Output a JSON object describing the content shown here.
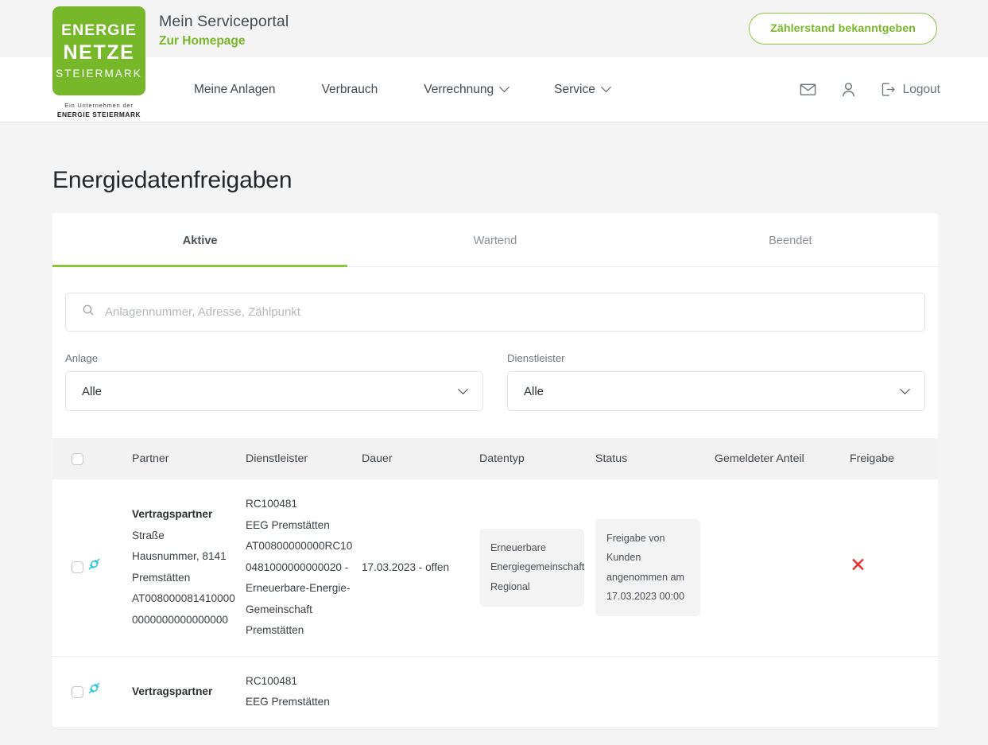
{
  "brand": {
    "logo_line1": "ENERGIE",
    "logo_line2": "NETZE",
    "logo_line3": "STEIERMARK",
    "logo_sub1": "Ein Unternehmen der",
    "logo_sub2": "ENERGIE STEIERMARK",
    "logo_color": "#76b82a",
    "portal_title": "Mein Serviceportal",
    "homepage_link": "Zur Homepage"
  },
  "topbar": {
    "cta_label": "Zählerstand bekanntgeben"
  },
  "nav": {
    "items": [
      {
        "label": "Meine Anlagen",
        "has_chevron": false
      },
      {
        "label": "Verbrauch",
        "has_chevron": false
      },
      {
        "label": "Verrechnung",
        "has_chevron": true
      },
      {
        "label": "Service",
        "has_chevron": true
      }
    ],
    "mail_icon": "envelope-icon",
    "account_icon": "person-icon",
    "logout_icon": "logout-icon",
    "logout_label": "Logout"
  },
  "page": {
    "title": "Energiedatenfreigaben"
  },
  "tabs": [
    {
      "label": "Aktive",
      "active": true
    },
    {
      "label": "Wartend",
      "active": false
    },
    {
      "label": "Beendet",
      "active": false
    }
  ],
  "search": {
    "icon": "search-icon",
    "placeholder": "Anlagennummer, Adresse, Zählpunkt",
    "value": ""
  },
  "filters": [
    {
      "label": "Anlage",
      "value": "Alle",
      "icon": "chevron-down-icon"
    },
    {
      "label": "Dienstleister",
      "value": "Alle",
      "icon": "chevron-down-icon"
    }
  ],
  "table": {
    "columns": [
      "",
      "",
      "Partner",
      "Dienstleister",
      "Dauer",
      "Datentyp",
      "Status",
      "Gemeldeter Anteil",
      "Freigabe"
    ],
    "rows": [
      {
        "checkbox": false,
        "plug_icon": "plug-icon",
        "partner_title": "Vertragspartner",
        "partner_address": "Straße Hausnummer, 8141 Premstätten",
        "partner_meterpoint": "AT008000081410000 0000000000000000",
        "dienstleister_id": "RC100481",
        "dienstleister_name": "EEG Premstätten",
        "dienstleister_code": "AT00800000000RC10 0481000000000020 - Erneuerbare-Energie-Gemeinschaft Premstätten",
        "dauer": "17.03.2023 - offen",
        "datentyp": "Erneuerbare Energiegemeinschaft Regional",
        "status": "Freigabe von Kunden angenommen am 17.03.2023 00:00",
        "gemeldeter_anteil": "",
        "freigabe_icon": "close-x-icon"
      },
      {
        "checkbox": false,
        "plug_icon": "plug-icon",
        "partner_title": "Vertragspartner",
        "partner_address": "",
        "partner_meterpoint": "",
        "dienstleister_id": "RC100481",
        "dienstleister_name": "EEG Premstätten",
        "dienstleister_code": "",
        "dauer": "",
        "datentyp": "",
        "status": "",
        "gemeldeter_anteil": "",
        "freigabe_icon": "close-x-icon"
      }
    ]
  },
  "colors": {
    "brand_green": "#76b82a",
    "accent_green": "#8cc63f",
    "plug_cyan": "#24c6e0",
    "danger_red": "#ee2b2b",
    "page_bg": "#f4f4f4"
  }
}
